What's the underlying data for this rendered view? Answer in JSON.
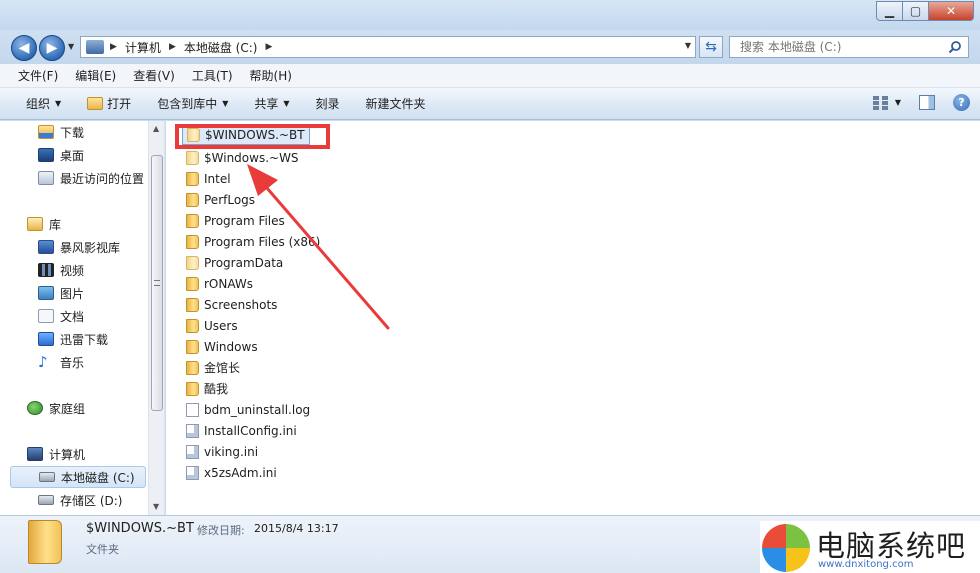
{
  "window": {
    "min": "▁",
    "max": "▢",
    "close": "✕"
  },
  "nav": {
    "breadcrumbs": [
      "计算机",
      "本地磁盘 (C:)"
    ],
    "search_placeholder": "搜索 本地磁盘 (C:)"
  },
  "menu": [
    "文件(F)",
    "编辑(E)",
    "查看(V)",
    "工具(T)",
    "帮助(H)"
  ],
  "toolbar": {
    "organize": "组织",
    "open": "打开",
    "include_in_library": "包含到库中",
    "share": "共享",
    "burn": "刻录",
    "new_folder": "新建文件夹"
  },
  "sidebar": {
    "favorites": [
      "下载",
      "桌面",
      "最近访问的位置"
    ],
    "libraries_label": "库",
    "libraries": [
      "暴风影视库",
      "视频",
      "图片",
      "文档",
      "迅雷下载",
      "音乐"
    ],
    "homegroup": "家庭组",
    "computer": "计算机",
    "drives": [
      "本地磁盘 (C:)",
      "存储区 (D:)"
    ]
  },
  "files": [
    {
      "name": "$WINDOWS.~BT",
      "type": "folder-light"
    },
    {
      "name": "$Windows.~WS",
      "type": "folder-light"
    },
    {
      "name": "Intel",
      "type": "folder"
    },
    {
      "name": "PerfLogs",
      "type": "folder"
    },
    {
      "name": "Program Files",
      "type": "folder"
    },
    {
      "name": "Program Files (x86)",
      "type": "folder"
    },
    {
      "name": "ProgramData",
      "type": "folder-light"
    },
    {
      "name": "rONAWs",
      "type": "folder"
    },
    {
      "name": "Screenshots",
      "type": "folder"
    },
    {
      "name": "Users",
      "type": "folder"
    },
    {
      "name": "Windows",
      "type": "folder"
    },
    {
      "name": "金馆长",
      "type": "folder"
    },
    {
      "name": "酷我",
      "type": "folder"
    },
    {
      "name": "bdm_uninstall.log",
      "type": "file"
    },
    {
      "name": "InstallConfig.ini",
      "type": "ini"
    },
    {
      "name": "viking.ini",
      "type": "ini"
    },
    {
      "name": "x5zsAdm.ini",
      "type": "ini"
    }
  ],
  "details": {
    "name": "$WINDOWS.~BT",
    "modified_label": "修改日期:",
    "modified_value": "2015/8/4 13:17",
    "type": "文件夹"
  },
  "watermark": {
    "title": "电脑系统吧",
    "url": "www.dnxitong.com"
  },
  "colors": {
    "highlight": "#ea3b3b",
    "selection": "#dbe9f9",
    "accent": "#2f6bb8"
  }
}
